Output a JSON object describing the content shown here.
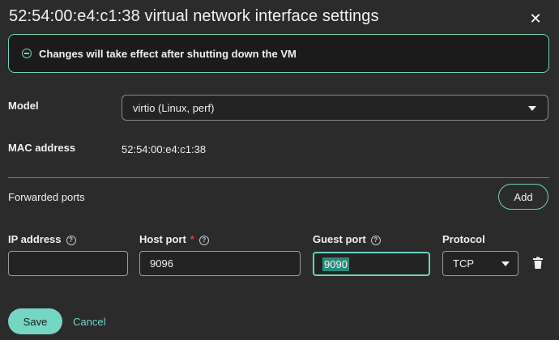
{
  "dialog": {
    "title": "52:54:00:e4:c1:38 virtual network interface settings",
    "close_icon": "close-icon"
  },
  "alert": {
    "text": "Changes will take effect after shutting down the VM",
    "icon": "info-circle-icon"
  },
  "model": {
    "label": "Model",
    "value": "virtio (Linux, perf)"
  },
  "mac": {
    "label": "MAC address",
    "value": "52:54:00:e4:c1:38"
  },
  "forwarded_ports": {
    "label": "Forwarded ports",
    "add_label": "Add"
  },
  "port_row": {
    "ip_label": "IP address",
    "ip_value": "",
    "host_port_label": "Host port",
    "host_port_required_mark": "*",
    "host_port_value": "9096",
    "guest_port_label": "Guest port",
    "guest_port_value": "9090",
    "protocol_label": "Protocol",
    "protocol_value": "TCP"
  },
  "footer": {
    "save_label": "Save",
    "cancel_label": "Cancel"
  },
  "colors": {
    "background": "#2b2b2b",
    "accent": "#73d7c4",
    "required": "#e03e3e"
  }
}
